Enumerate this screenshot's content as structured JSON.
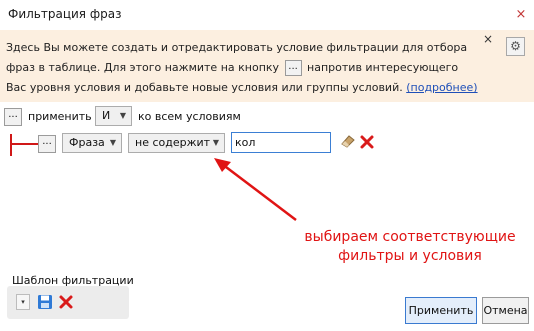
{
  "window": {
    "title": "Фильтрация фраз",
    "close_glyph": "×"
  },
  "info": {
    "text_part1": "Здесь Вы можете создать и отредактировать условие фильтрации для отбора фраз в таблице. Для этого нажмите на кнопку",
    "inline_button": "...",
    "text_part2": "напротив интересующего Вас уровня условия и добавьте новые условия или группы условий.",
    "link": "(подробнее)",
    "close_glyph": "×",
    "gear_glyph": "⚙"
  },
  "group_row": {
    "menu_button": "...",
    "apply_label": "применить",
    "operator_value": "И",
    "to_all_label": "ко всем условиям"
  },
  "condition_row": {
    "menu_button": "...",
    "field_value": "Фраза",
    "operator_value": "не содержит",
    "value_input": "кол"
  },
  "annotation": {
    "text_line1": "выбираем соответствующие",
    "text_line2": "фильтры и условия"
  },
  "template": {
    "label": "Шаблон фильтрации",
    "dropdown_glyph": "▾"
  },
  "footer": {
    "apply_label": "Применить",
    "cancel_label": "Отмена"
  },
  "colors": {
    "accent": "#3a7ad0",
    "annotation_red": "#e01414",
    "info_bg": "#fcefe0"
  },
  "icons": [
    "close-icon",
    "gear-icon",
    "eraser-icon",
    "delete-icon",
    "save-icon",
    "dropdown-arrow-icon"
  ]
}
